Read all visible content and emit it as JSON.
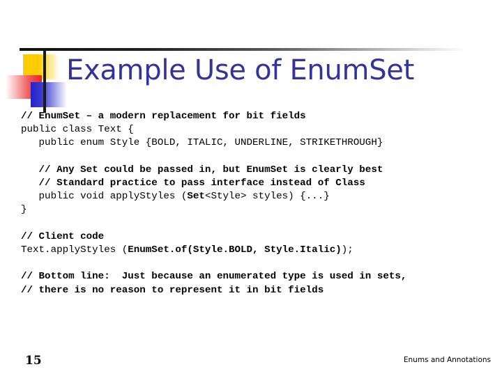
{
  "slide": {
    "title": "Example Use of EnumSet",
    "title_color": "#333399",
    "page_number": "15",
    "footer": "Enums and Annotations"
  },
  "logo": {
    "yellow_color": "#FFCC00",
    "red_color": "#EE2222",
    "blue_color": "#2222CC",
    "bar_color": "#1a1a1a"
  },
  "code": {
    "lines": [
      {
        "id": "line-1",
        "segments": [
          {
            "text": "// EnumSet – a modern replacement for bit fields",
            "bold": true
          }
        ]
      },
      {
        "id": "line-2",
        "segments": [
          {
            "text": "public class Text {",
            "bold": false
          }
        ]
      },
      {
        "id": "line-3",
        "segments": [
          {
            "text": "   public enum Style {BOLD, ITALIC, UNDERLINE, STRIKETHROUGH}",
            "bold": false
          }
        ]
      },
      {
        "id": "line-4",
        "segments": [
          {
            "text": "",
            "bold": false
          }
        ]
      },
      {
        "id": "line-5",
        "segments": [
          {
            "text": "   // Any Set could be passed in, but EnumSet is clearly best",
            "bold": true
          }
        ]
      },
      {
        "id": "line-6",
        "segments": [
          {
            "text": "   // Standard practice to pass interface instead of Class",
            "bold": true
          }
        ]
      },
      {
        "id": "line-7",
        "segments": [
          {
            "text": "   public void applyStyles (",
            "bold": false
          },
          {
            "text": "Set",
            "bold": true
          },
          {
            "text": "<Style> styles) {...}",
            "bold": false
          }
        ]
      },
      {
        "id": "line-8",
        "segments": [
          {
            "text": "}",
            "bold": false
          }
        ]
      },
      {
        "id": "line-9",
        "segments": [
          {
            "text": "",
            "bold": false
          }
        ]
      },
      {
        "id": "line-10",
        "segments": [
          {
            "text": "// Client code",
            "bold": true
          }
        ]
      },
      {
        "id": "line-11",
        "segments": [
          {
            "text": "Text.applyStyles (",
            "bold": false
          },
          {
            "text": "EnumSet.of(Style.BOLD, Style.Italic)",
            "bold": true
          },
          {
            "text": ");",
            "bold": false
          }
        ]
      },
      {
        "id": "line-12",
        "segments": [
          {
            "text": "",
            "bold": false
          }
        ]
      },
      {
        "id": "line-13",
        "segments": [
          {
            "text": "// Bottom line:  Just because an enumerated type is used in sets,",
            "bold": true
          }
        ]
      },
      {
        "id": "line-14",
        "segments": [
          {
            "text": "// there is no reason to represent it in bit fields",
            "bold": true
          }
        ]
      }
    ]
  }
}
